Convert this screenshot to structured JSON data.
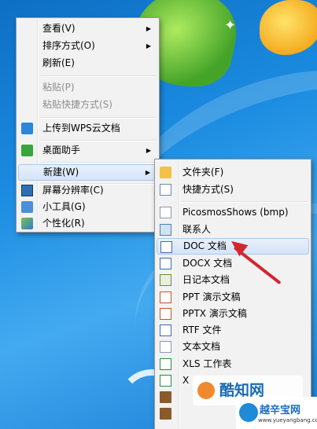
{
  "context_menu": {
    "items": [
      {
        "label": "查看(V)",
        "has_submenu": true
      },
      {
        "label": "排序方式(O)",
        "has_submenu": true
      },
      {
        "label": "刷新(E)"
      },
      {
        "label": "粘贴(P)",
        "disabled": true
      },
      {
        "label": "粘贴快捷方式(S)",
        "disabled": true
      },
      {
        "label": "上传到WPS云文档",
        "icon": "wps-cloud-icon"
      },
      {
        "label": "桌面助手",
        "icon": "desktop-helper-icon",
        "has_submenu": true
      },
      {
        "label": "新建(W)",
        "has_submenu": true,
        "highlighted": true
      },
      {
        "label": "屏幕分辨率(C)",
        "icon": "monitor-icon"
      },
      {
        "label": "小工具(G)",
        "icon": "gadget-icon"
      },
      {
        "label": "个性化(R)",
        "icon": "personalize-icon"
      }
    ]
  },
  "new_submenu": {
    "items": [
      {
        "label": "文件夹(F)",
        "icon": "folder-icon"
      },
      {
        "label": "快捷方式(S)",
        "icon": "shortcut-icon"
      },
      {
        "label": "PicosmosShows (bmp)",
        "icon": "bmp-file-icon"
      },
      {
        "label": "联系人",
        "icon": "contact-icon"
      },
      {
        "label": "DOC 文档",
        "icon": "doc-icon",
        "highlighted": true
      },
      {
        "label": "DOCX 文档",
        "icon": "docx-icon"
      },
      {
        "label": "日记本文档",
        "icon": "journal-icon"
      },
      {
        "label": "PPT 演示文稿",
        "icon": "ppt-icon"
      },
      {
        "label": "PPTX 演示文稿",
        "icon": "pptx-icon"
      },
      {
        "label": "RTF 文件",
        "icon": "rtf-icon"
      },
      {
        "label": "文本文档",
        "icon": "txt-icon"
      },
      {
        "label": "XLS 工作表",
        "icon": "xls-icon"
      },
      {
        "label": "X",
        "icon": "xlsx-icon"
      },
      {
        "label": "",
        "icon": "zip-icon"
      },
      {
        "label": "",
        "icon": "briefcase-icon"
      }
    ]
  },
  "watermarks": {
    "site1": "酷知网",
    "site2_title": "越辛宝网",
    "site2_url": "www.yueyangbang.com"
  },
  "colors": {
    "annotation_arrow": "#d3262e",
    "menu_bg": "#f2f2f2",
    "highlight": "#d4e4f8"
  }
}
